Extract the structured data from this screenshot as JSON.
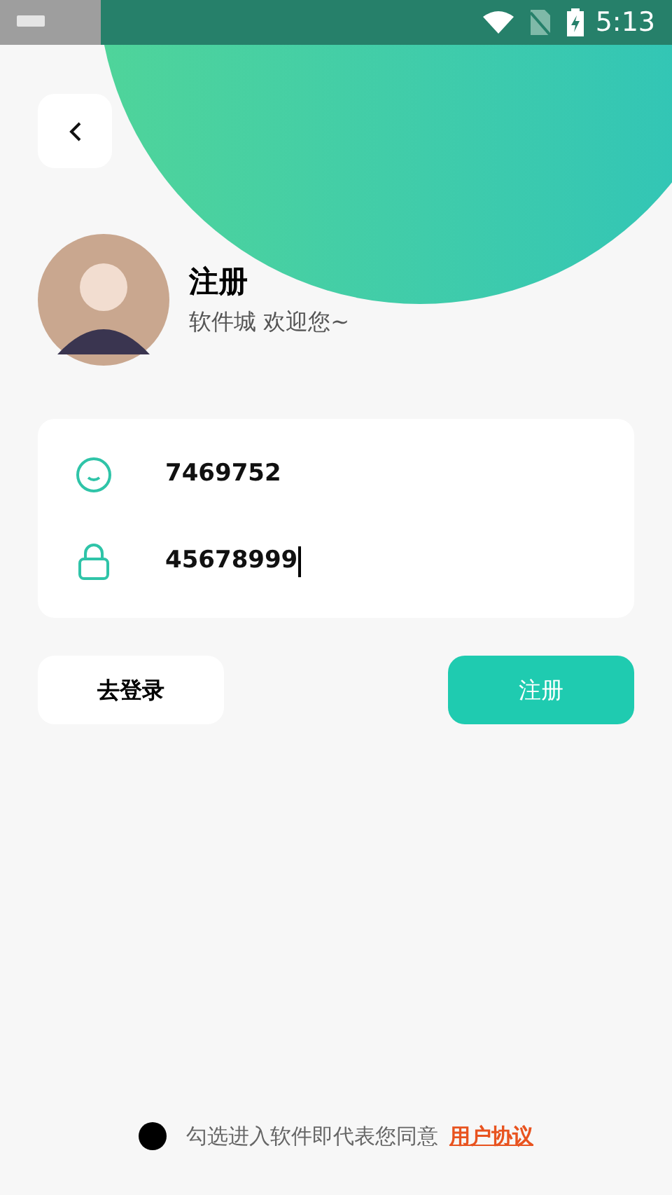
{
  "status_bar": {
    "time": "5:13"
  },
  "header": {
    "title": "注册",
    "subtitle": "软件城 欢迎您~"
  },
  "form": {
    "fields": [
      {
        "kind": "account",
        "value": "7469752",
        "focused": false
      },
      {
        "kind": "password",
        "value": "45678999",
        "focused": true
      }
    ]
  },
  "buttons": [
    {
      "kind": "secondary",
      "label": "去登录"
    },
    {
      "kind": "primary",
      "label": "注册"
    }
  ],
  "agreement": {
    "checked": false,
    "text": "勾选进入软件即代表您同意",
    "link": "用户协议"
  }
}
